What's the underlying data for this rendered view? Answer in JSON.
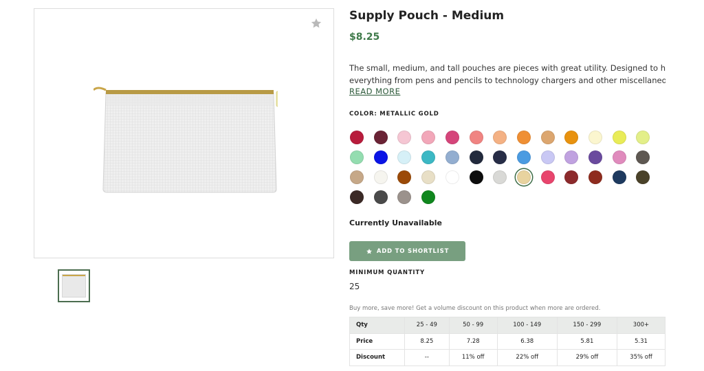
{
  "product": {
    "title": "Supply Pouch - Medium",
    "price": "$8.25",
    "description_line1": "The small, medium, and tall pouches are pieces with great utility. Designed to hold",
    "description_line2": "everything from pens and pencils to technology chargers and other miscellaneous…",
    "read_more": "READ MORE",
    "color_label": "COLOR: METALLIC GOLD",
    "availability": "Currently Unavailable",
    "shortlist_label": "ADD TO SHORTLIST",
    "min_qty_label": "MINIMUM QUANTITY",
    "min_qty_value": "25",
    "volume_note": "Buy more, save more! Get a volume discount on this product when more are ordered."
  },
  "icons": {
    "favorite": "star-icon",
    "shortlist": "star-icon"
  },
  "colors": {
    "accent_green": "#3f7a4a",
    "button_green": "#789f80",
    "selected_ring": "#3b6b45"
  },
  "swatches": [
    "#b81c3c",
    "#6a2335",
    "#f5c6d3",
    "#f2a7b9",
    "#d5457a",
    "#f08482",
    "#f4b184",
    "#ef8f34",
    "#dca66f",
    "#e8920f",
    "#fbf6cf",
    "#e9ec58",
    "#e3ef89",
    "#94ddb0",
    "#0a14e6",
    "#d6f0f7",
    "#3cb8c4",
    "#93aed0",
    "#222a3d",
    "#272d47",
    "#4b9be1",
    "#c9c8f4",
    "#c0a2e0",
    "#6a4a9e",
    "#e08bbd",
    "#5e5852",
    "#c6a888",
    "#f6f5ef",
    "#9b4a08",
    "#e8dfc6",
    "#ffffff",
    "#0d0d0d",
    "#d9d9d6",
    "#e8d39f",
    "#e8456d",
    "#8c2a2c",
    "#8e2c1f",
    "#1e3a5f",
    "#4a4229",
    "#3b2a26",
    "#4a4a4a",
    "#9b928c",
    "#10871e"
  ],
  "selected_swatch_index": 33,
  "pricing_table": {
    "headers": [
      "Qty",
      "25 - 49",
      "50 - 99",
      "100 - 149",
      "150 - 299",
      "300+"
    ],
    "rows": [
      {
        "label": "Price",
        "values": [
          "8.25",
          "7.28",
          "6.38",
          "5.81",
          "5.31"
        ]
      },
      {
        "label": "Discount",
        "values": [
          "--",
          "11% off",
          "22% off",
          "29% off",
          "35% off"
        ]
      }
    ]
  }
}
